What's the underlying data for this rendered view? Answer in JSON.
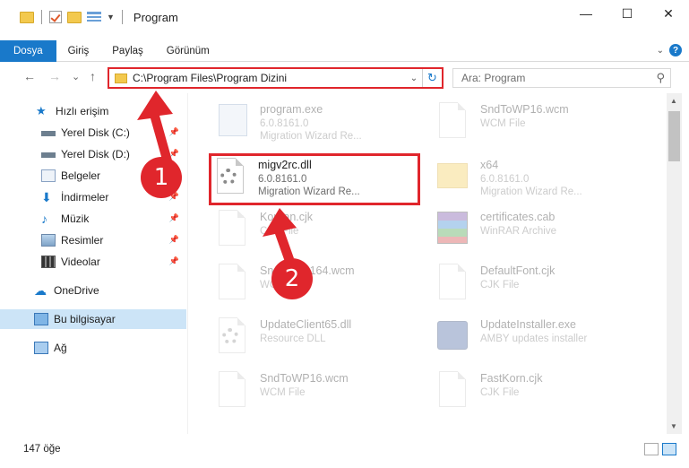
{
  "window": {
    "title": "Program",
    "controls": {
      "minimize": "—",
      "maximize": "☐",
      "close": "✕"
    }
  },
  "ribbon": {
    "tabs": [
      "Dosya",
      "Giriş",
      "Paylaş",
      "Görünüm"
    ],
    "active_tab": "Dosya",
    "accent": "#1979ca"
  },
  "address_bar": {
    "path": "C:\\Program Files\\Program Dizini",
    "back": "←",
    "forward": "→",
    "recent": "⌄",
    "up": "↑",
    "refresh": "↻"
  },
  "search": {
    "placeholder": "Ara: Program",
    "icon": "search-icon"
  },
  "sidebar": {
    "items": [
      {
        "label": "Hızlı erişim",
        "icon": "star-icon",
        "pinned": false
      },
      {
        "label": "Yerel Disk (C:)",
        "icon": "drive-icon",
        "pinned": true
      },
      {
        "label": "Yerel Disk (D:)",
        "icon": "drive-icon",
        "pinned": true
      },
      {
        "label": "Belgeler",
        "icon": "documents-icon",
        "pinned": true
      },
      {
        "label": "İndirmeler",
        "icon": "download-icon",
        "pinned": true
      },
      {
        "label": "Müzik",
        "icon": "music-icon",
        "pinned": true
      },
      {
        "label": "Resimler",
        "icon": "pictures-icon",
        "pinned": true
      },
      {
        "label": "Videolar",
        "icon": "videos-icon",
        "pinned": true
      },
      {
        "label": "OneDrive",
        "icon": "cloud-icon",
        "pinned": false
      },
      {
        "label": "Bu bilgisayar",
        "icon": "computer-icon",
        "pinned": false,
        "selected": true
      },
      {
        "label": "Ağ",
        "icon": "network-icon",
        "pinned": false
      }
    ]
  },
  "files": [
    {
      "name": "program.exe",
      "line2": "6.0.8161.0",
      "line3": "Migration Wizard Re...",
      "icon": "exe-icon"
    },
    {
      "name": "SndToWP16.wcm",
      "line2": "WCM File",
      "line3": "",
      "icon": "document-icon"
    },
    {
      "name": "migv2rc.dll",
      "line2": "6.0.8161.0",
      "line3": "Migration Wizard Re...",
      "icon": "dll-gear-icon",
      "highlighted": true
    },
    {
      "name": "x64",
      "line2": "6.0.8161.0",
      "line3": "Migration Wizard Re...",
      "icon": "folder-icon"
    },
    {
      "name": "Korean.cjk",
      "line2": "CJK File",
      "line3": "",
      "icon": "document-icon"
    },
    {
      "name": "certificates.cab",
      "line2": "WinRAR Archive",
      "line3": "",
      "icon": "winrar-icon"
    },
    {
      "name": "SndToWP164.wcm",
      "line2": "WCM File",
      "line3": "",
      "icon": "document-icon"
    },
    {
      "name": "DefaultFont.cjk",
      "line2": "CJK File",
      "line3": "",
      "icon": "document-icon"
    },
    {
      "name": "UpdateClient65.dll",
      "line2": "Resource DLL",
      "line3": "",
      "icon": "dll-gear-icon"
    },
    {
      "name": "UpdateInstaller.exe",
      "line2": "AMBY updates installer",
      "line3": "",
      "icon": "amby-icon"
    },
    {
      "name": "SndToWP16.wcm",
      "line2": "WCM File",
      "line3": "",
      "icon": "document-icon"
    },
    {
      "name": "FastKorn.cjk",
      "line2": "CJK File",
      "line3": "",
      "icon": "document-icon"
    }
  ],
  "status": {
    "item_count": "147 öğe"
  },
  "annotations": {
    "step1": "1",
    "step2": "2",
    "color": "#e0262c"
  }
}
